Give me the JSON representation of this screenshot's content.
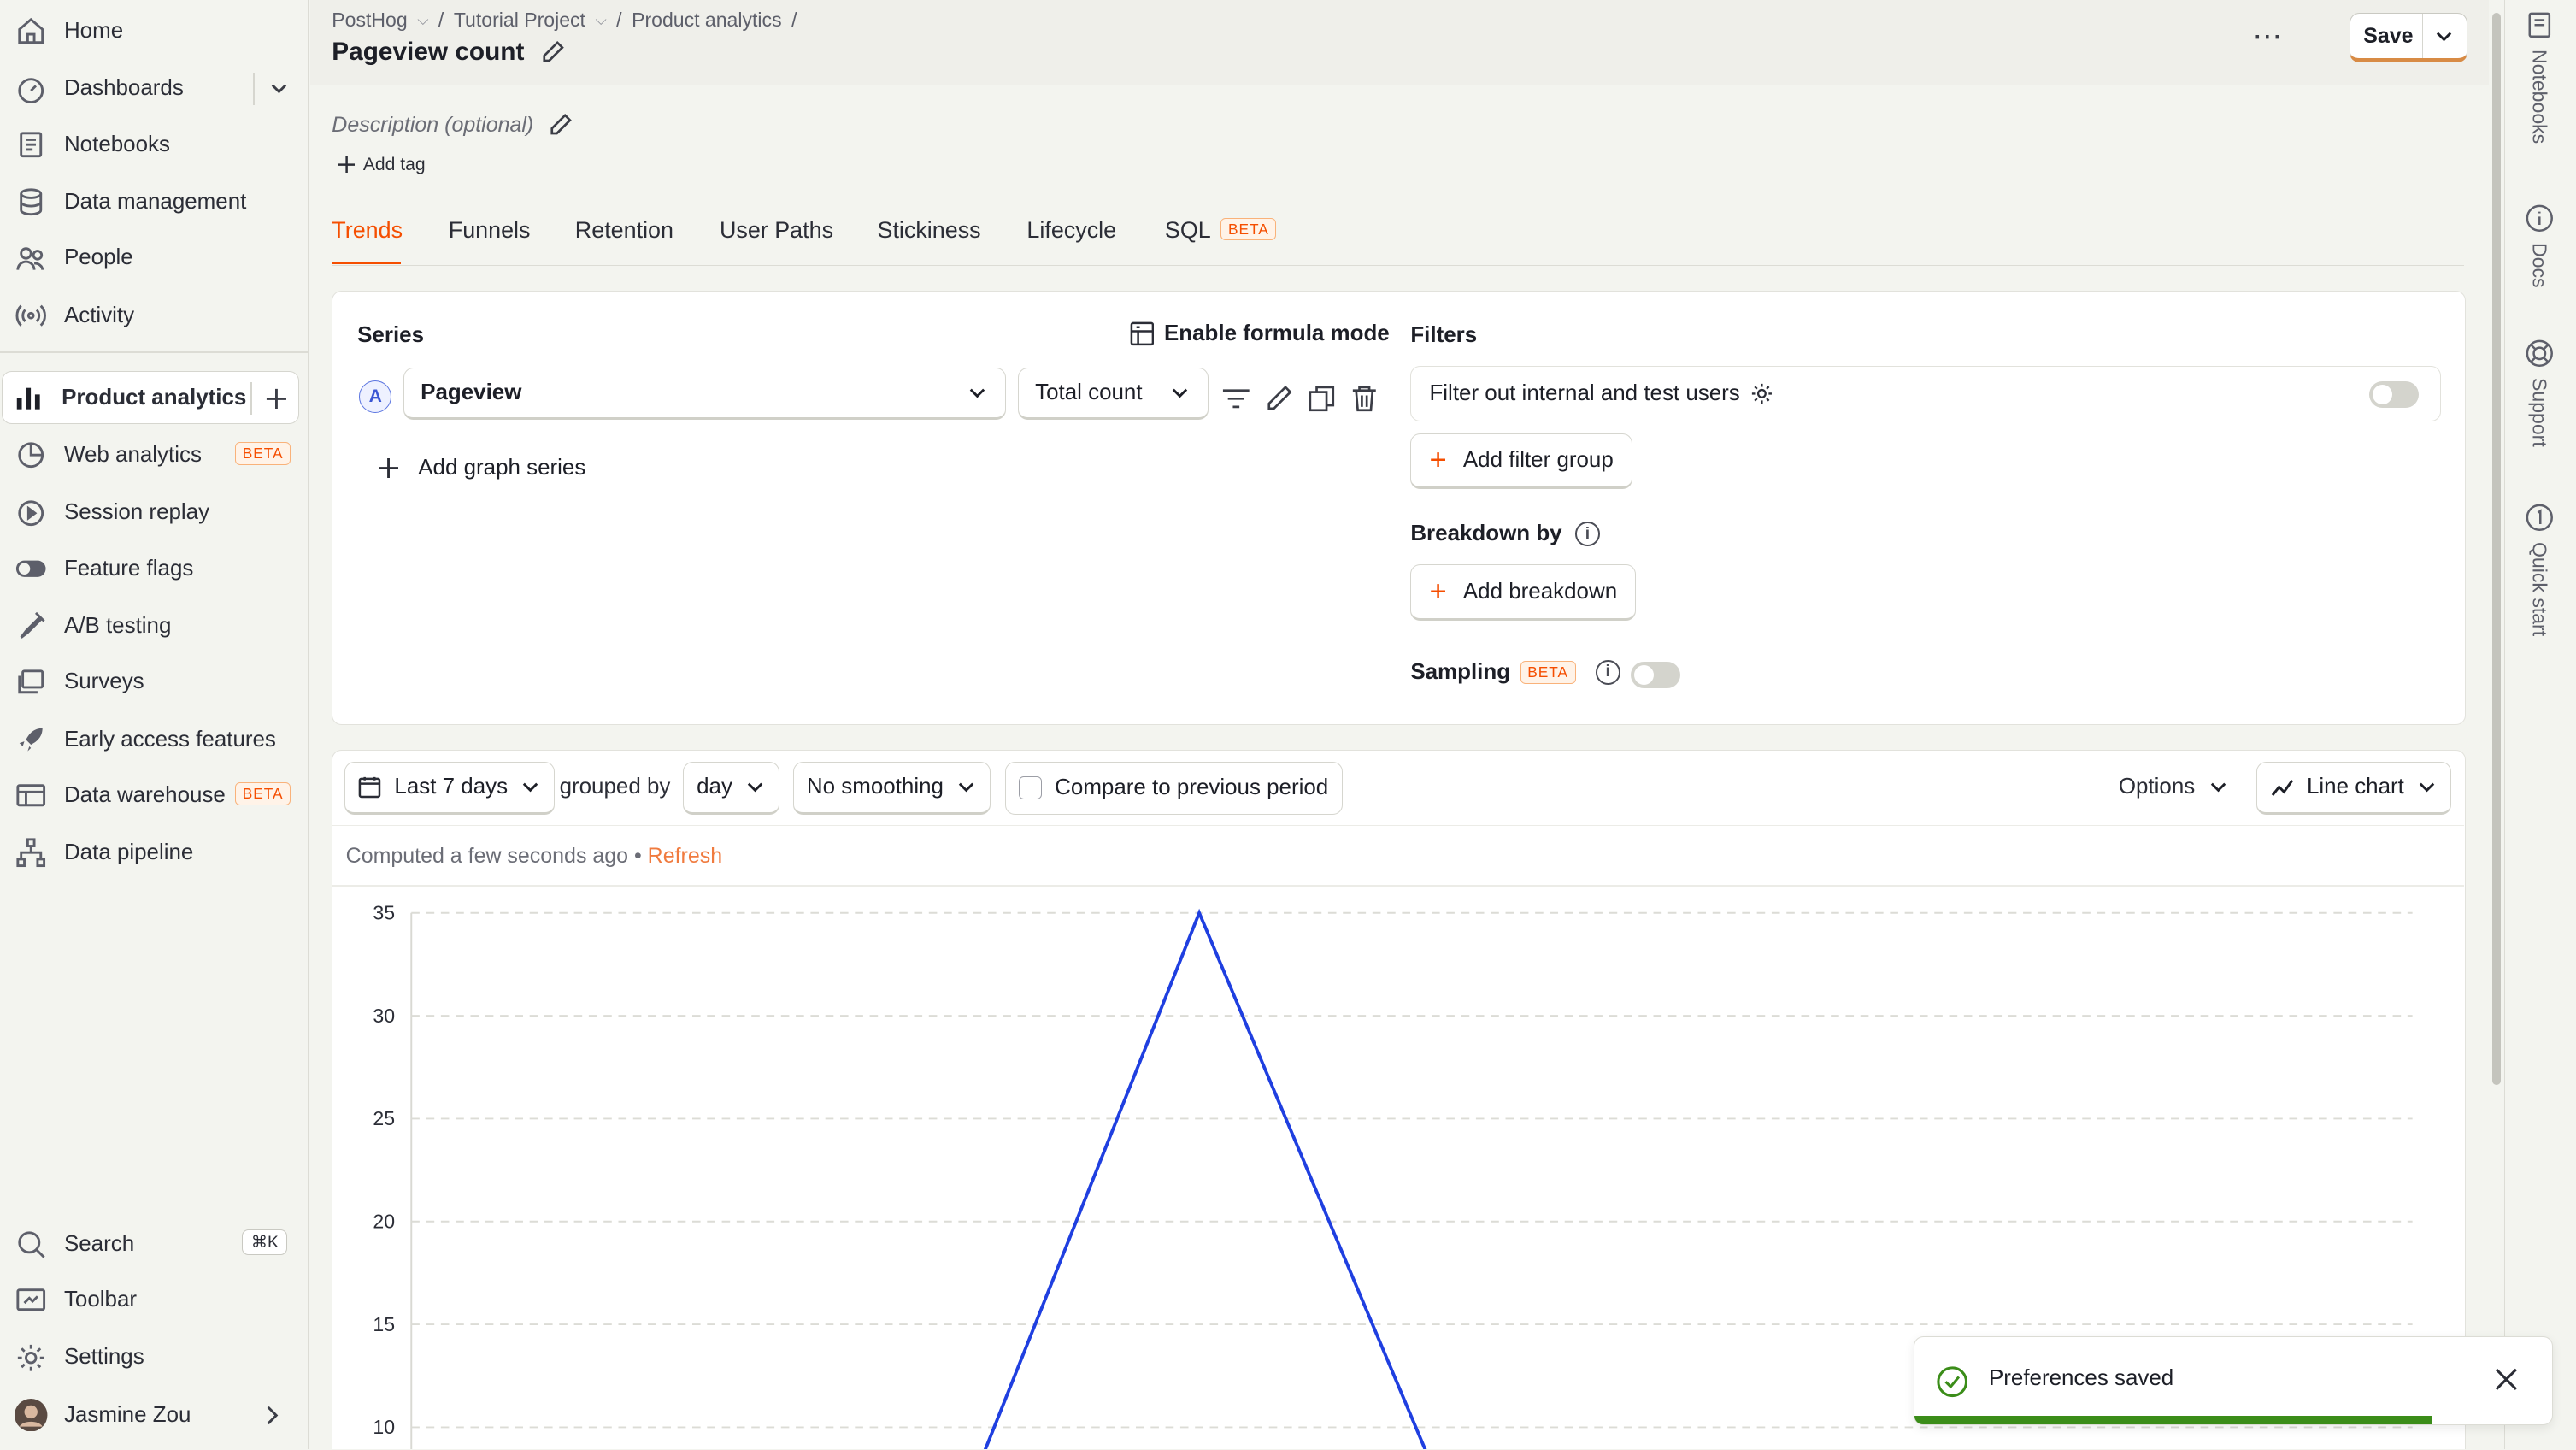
{
  "sidebar": {
    "items": [
      {
        "label": "Home",
        "icon": "home-icon"
      },
      {
        "label": "Dashboards",
        "icon": "dashboard-icon"
      },
      {
        "label": "Notebooks",
        "icon": "notebook-icon"
      },
      {
        "label": "Data management",
        "icon": "database-icon"
      },
      {
        "label": "People",
        "icon": "people-icon"
      },
      {
        "label": "Activity",
        "icon": "activity-icon"
      },
      {
        "label": "Product analytics",
        "icon": "bar-chart-icon"
      },
      {
        "label": "Web analytics",
        "icon": "web-analytics-icon",
        "badge": "BETA"
      },
      {
        "label": "Session replay",
        "icon": "replay-icon"
      },
      {
        "label": "Feature flags",
        "icon": "toggle-icon"
      },
      {
        "label": "A/B testing",
        "icon": "flask-icon"
      },
      {
        "label": "Surveys",
        "icon": "survey-icon"
      },
      {
        "label": "Early access features",
        "icon": "rocket-icon"
      },
      {
        "label": "Data warehouse",
        "icon": "warehouse-icon",
        "badge": "BETA"
      },
      {
        "label": "Data pipeline",
        "icon": "pipeline-icon"
      }
    ],
    "bottom": [
      {
        "label": "Search",
        "icon": "search-icon",
        "shortcut": "⌘K"
      },
      {
        "label": "Toolbar",
        "icon": "toolbar-icon"
      },
      {
        "label": "Settings",
        "icon": "gear-icon"
      },
      {
        "label": "Jasmine Zou",
        "icon": "avatar"
      }
    ]
  },
  "breadcrumbs": [
    "PostHog",
    "Tutorial Project",
    "Product analytics"
  ],
  "title": "Pageview count",
  "save_label": "Save",
  "description_placeholder": "Description (optional)",
  "add_tag": "Add tag",
  "tabs": [
    "Trends",
    "Funnels",
    "Retention",
    "User Paths",
    "Stickiness",
    "Lifecycle",
    "SQL"
  ],
  "sql_badge": "BETA",
  "series": {
    "heading": "Series",
    "formula_mode": "Enable formula mode",
    "letter": "A",
    "event": "Pageview",
    "aggregation": "Total count",
    "add_series": "Add graph series"
  },
  "filters": {
    "heading": "Filters",
    "internal_filter": "Filter out internal and test users",
    "add_filter_group": "Add filter group",
    "breakdown_heading": "Breakdown by",
    "add_breakdown": "Add breakdown",
    "sampling": "Sampling",
    "sampling_badge": "BETA"
  },
  "toolbar": {
    "date_range": "Last 7 days",
    "grouped_by": "grouped by",
    "interval": "day",
    "smoothing": "No smoothing",
    "compare": "Compare to previous period",
    "options": "Options",
    "chart_type": "Line chart"
  },
  "computed": {
    "text": "Computed a few seconds ago",
    "bullet": "•",
    "refresh": "Refresh"
  },
  "chart_data": {
    "type": "line",
    "title": "",
    "xlabel": "",
    "ylabel": "",
    "y_ticks": [
      "35",
      "30",
      "25",
      "20",
      "15",
      "10"
    ],
    "ylim_visible": [
      10,
      35
    ],
    "series": [
      {
        "x_fraction": [
          0.18,
          0.287,
          0.4
        ],
        "values": [
          8.9,
          35,
          8.9
        ]
      }
    ],
    "color": "#1f3fe0",
    "grid": true
  },
  "rightbar": [
    "Notebooks",
    "Docs",
    "Support",
    "Quick start"
  ],
  "toast": {
    "message": "Preferences saved"
  },
  "colors": {
    "accent": "#f54e00",
    "line": "#1f3fe0",
    "success": "#3b8d19"
  }
}
